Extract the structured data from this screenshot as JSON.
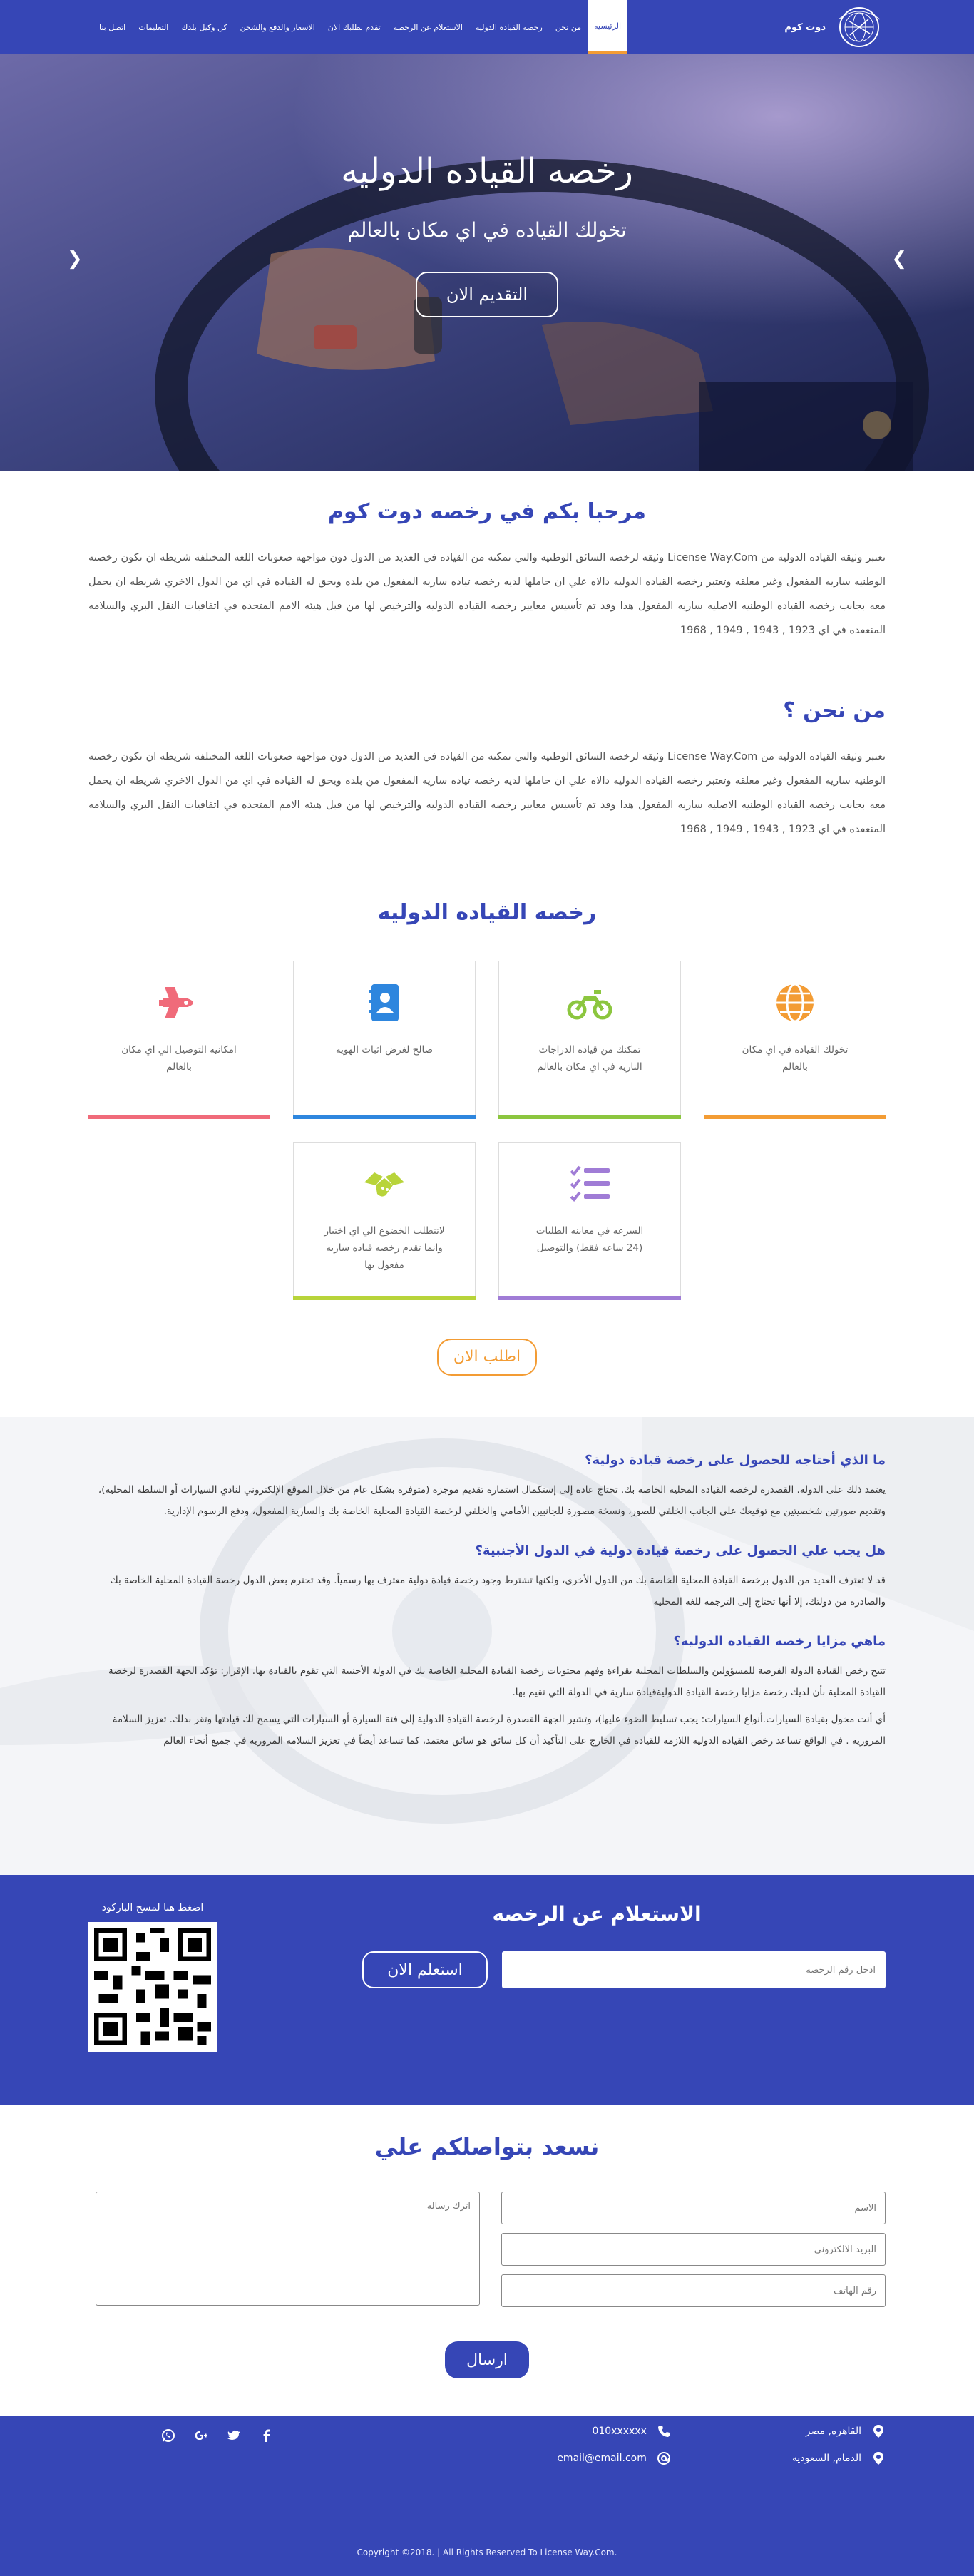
{
  "nav": {
    "brand": "دوت كوم",
    "items": [
      "الرئيسيه",
      "من نحن",
      "رخصه القياده الدوليه",
      "الاستعلام عن الرخصه",
      "تقدم بطلبك الان",
      "الاسعار والدفع والشحن",
      "كن وكيل بلدك",
      "التعليمات",
      "اتصل بنا"
    ],
    "active_index": 0
  },
  "hero": {
    "title": "رخصه القياده الدوليه",
    "subtitle": "تخولك القياده في اي مكان بالعالم",
    "button": "التقديم الان",
    "prev_icon": "chevron-left-icon",
    "next_icon": "chevron-right-icon"
  },
  "welcome": {
    "title": "مرحبا بكم في رخصه دوت كوم",
    "text": "تعتبر وثيقه القياده الدوليه من License Way.Com وثيقه لرخصه السائق الوطنيه والتي تمكنه من القياده في العديد من الدول دون مواجهه صعوبات اللغه المختلفه شريطه ان تكون رخصته الوطنيه ساريه المفعول وغير معلقه وتعتبر رخصه القياده الدوليه دالاه علي ان حاملها لديه رخصه تياده ساريه المفعول من بلده ويحق له القياده في اي من الدول الاخري شريطه ان يحمل معه بجانب رخصه القياده الوطنيه الاصليه ساريه المفعول هذا وقد تم تأسيس معايير رخصه القياده الدوليه والترخيص لها من قبل هيئه الامم المتحده في اتفاقيات النقل البري والسلامه المنعقده في اي 1923 , 1943 , 1949 , 1968"
  },
  "about": {
    "title": "من نحن ؟",
    "text": "تعتبر وثيقه القياده الدوليه من License Way.Com وثيقه لرخصه السائق الوطنيه والتي تمكنه من القياده في العديد من الدول دون مواجهه صعوبات اللغه المختلفه شريطه ان تكون رخصته الوطنيه ساريه المفعول وغير معلقه وتعتبر رخصه القياده الدوليه دالاه علي ان حاملها لديه رخصه تياده ساريه المفعول من بلده ويحق له القياده في اي من الدول الاخري شريطه ان يحمل معه بجانب رخصه القياده الوطنيه الاصليه ساريه المفعول هذا وقد تم تأسيس معايير رخصه القياده الدوليه والترخيص لها من قبل هيئه الامم المتحده في اتفاقيات النقل البري والسلامه المنعقده في اي 1923 , 1943 , 1949 , 1968"
  },
  "features": {
    "title": "رخصه القياده الدوليه",
    "cards": [
      {
        "text": "تخولك القياده في اي مكان بالعالم",
        "icon": "globe-icon",
        "color": "#f39c34"
      },
      {
        "text": "تمكنك من قياده الدراجات النارية في اي مكان بالعالم",
        "icon": "motorcycle-icon",
        "color": "#8cc63f"
      },
      {
        "text": "صالح لغرض اثبات الهويه",
        "icon": "address-book-icon",
        "color": "#2e86de"
      },
      {
        "text": "امكانيه التوصيل الي اي مكان بالعالم",
        "icon": "space-shuttle-icon",
        "color": "#f06b7a"
      },
      {
        "text": "السرعه في معاينه الطلبات (24 ساعه فقط) والتوصيل",
        "icon": "tasks-icon",
        "color": "#a07cd6"
      },
      {
        "text": "لاتتطلب الخضوع الي اي اختبار وانما تقدم رخصه قياده ساريه مفعول بها",
        "icon": "handshake-icon",
        "color": "#b8d43a"
      }
    ],
    "cta": "اطلب الان"
  },
  "faq": [
    {
      "q": "ما الذي أحتاجه للحصول على رخصة قيادة دولية؟",
      "a": "يعتمد ذلك على الدولة. القصدرة لرخصة القيادة المحلية الخاصة بك. تحتاج عادة إلى إستكمال استمارة تقديم موجزة (متوفرة بشكل عام من خلال الموقع الإلكتروني لنادي السيارات أو السلطة المحلية)، وتقديم صورتين شخصيتين مع توقيعك على الجانب الخلفي للصور، ونسخة مصورة للجانبين الأمامي والخلفي لرخصة القيادة المحلية الخاصة بك والسارية المفعول، ودفع الرسوم الإدارية."
    },
    {
      "q": "هل يجب علي الحصول على رخصة قيادة دولية في الدول الأجنبية؟",
      "a": "قد لا تعترف العديد من الدول برخصة القيادة المحلية الخاصة بك من الدول الأخرى، ولكنها تشترط وجود رخصة قيادة دولية معترف بها رسمياً. وقد تحترم بعض الدول رخصة القيادة المحلية الخاصة بك والصادرة من دولتك، إلا أنها تحتاج إلى الترجمة للغة المحلية"
    },
    {
      "q": "ماهي مزايا رخصه القياده الدوليه؟",
      "a": "تتيح رخص القيادة الدولة الفرصة للمسؤولين والسلطات المحلية بقراءة وفهم محتويات رخصة القيادة المحلية الخاصة بك في الدولة الأجنبية التي تقوم بالقيادة بها. الإقرار: تؤكد الجهة القصدرة لرخصة القيادة المحلية بأن لديك رخصة مزايا رخصة القيادة الدوليةقيادة سارية في الدولة التي تقيم بها.",
      "a2": "أي أنت مخول بقيادة السيارات.أنواع السيارات: يجب تسليط الضوء عليها)، وتشير الجهة القصدرة لرخصة القيادة الدولية إلى فئة السيارة أو السيارات التي يسمح لك قيادتها وتقر بذلك. تعزيز السلامة المرورية . في الواقع تساعد رخص القيادة الدولية اللازمة للقيادة في الخارج على التأكيد أن كل سائق هو سائق معتمد، كما تساعد أيضاً في تعزيز السلامة المرورية في جميع أنحاء العالم"
    }
  ],
  "inquiry": {
    "title": "الاستعلام عن الرخصه",
    "placeholder": "ادخل رقم الرخصه",
    "button": "استعلم الان",
    "qr_label": "اضغط هنا لمسح الباركود"
  },
  "contact": {
    "title": "نسعد بتواصلكم علي",
    "name_placeholder": "الاسم",
    "email_placeholder": "البريد الالكتروني",
    "phone_placeholder": "رقم الهاتف",
    "message_placeholder": "اترك رساله",
    "send": "ارسال"
  },
  "footer": {
    "address1": "القاهره, مصر",
    "address2": "الدمام, السعوديه",
    "phone": "010xxxxxx",
    "email": "email@email.com",
    "socials": [
      "facebook-icon",
      "twitter-icon",
      "google-plus-icon",
      "whatsapp-icon"
    ],
    "copyright": "Copyright ©2018. | All Rights Reserved To License Way.Com."
  }
}
